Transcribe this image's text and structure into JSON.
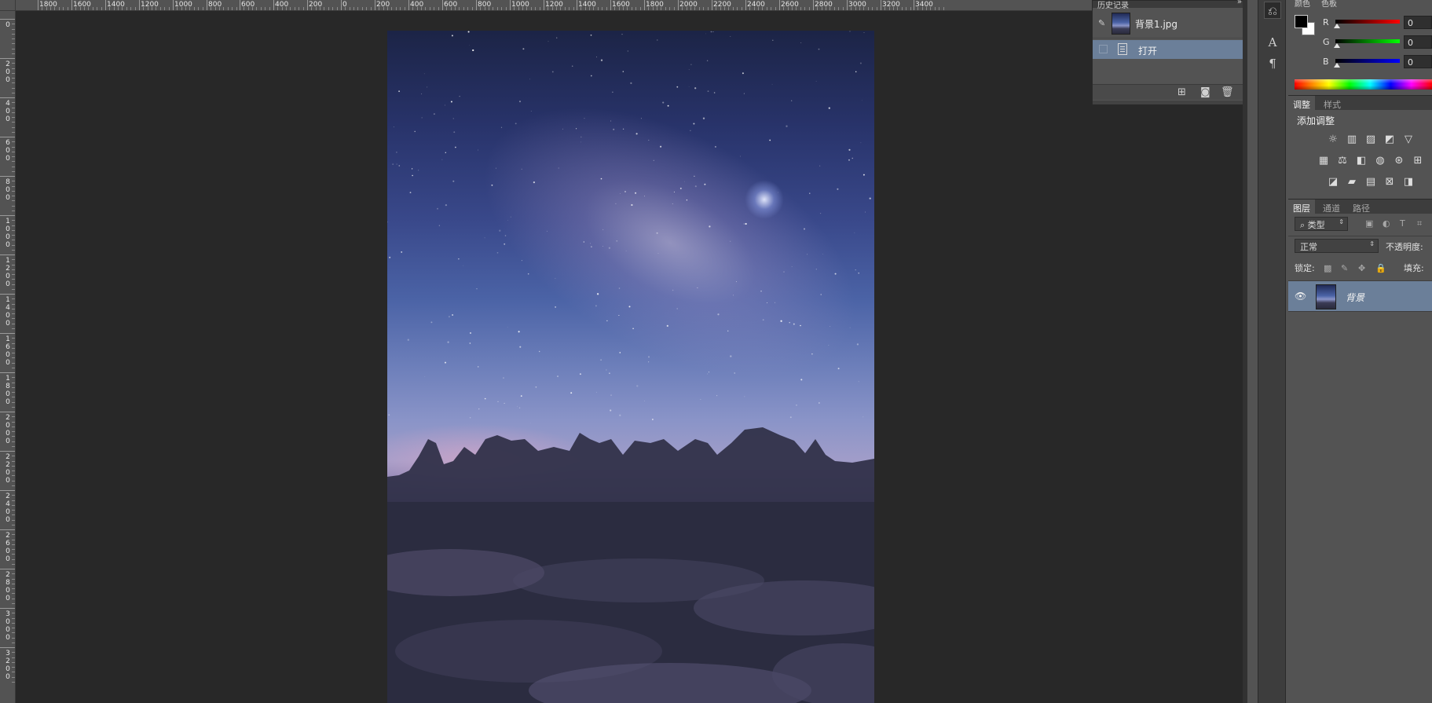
{
  "rulers": {
    "top": [
      "1800",
      "1600",
      "1400",
      "1200",
      "1000",
      "800",
      "600",
      "400",
      "200",
      "0",
      "200",
      "400",
      "600",
      "800",
      "1000",
      "1200",
      "1400",
      "1600",
      "1800",
      "2000",
      "2200",
      "2400",
      "2600",
      "2800",
      "3000",
      "3200",
      "3400"
    ],
    "left": [
      "0",
      "200",
      "400",
      "600",
      "800",
      "1000",
      "1200",
      "1400",
      "1600",
      "1800",
      "2000",
      "2200",
      "2400",
      "2600",
      "2800",
      "3000",
      "3200"
    ]
  },
  "history": {
    "title": "历史记录",
    "snapshot_name": "背景1.jpg",
    "state_name": "打开",
    "footer_icons": [
      "new-document-from-state-icon",
      "camera-icon",
      "trash-icon"
    ]
  },
  "color": {
    "tabs": [
      "颜色",
      "色板"
    ],
    "channels": [
      {
        "label": "R",
        "value": "0",
        "color": "#e00000"
      },
      {
        "label": "G",
        "value": "0",
        "color": "#00c000"
      },
      {
        "label": "B",
        "value": "0",
        "color": "#0000e0"
      }
    ],
    "foreground": "#000000",
    "background": "#ffffff"
  },
  "adjust": {
    "tabs": [
      "调整",
      "样式"
    ],
    "title": "添加调整"
  },
  "layers": {
    "tabs": [
      "图层",
      "通道",
      "路径"
    ],
    "filter_kind": "类型",
    "blend_mode": "正常",
    "opacity_label": "不透明度:",
    "lock_label": "锁定:",
    "fill_label": "填充:",
    "layer_name": "背景"
  }
}
